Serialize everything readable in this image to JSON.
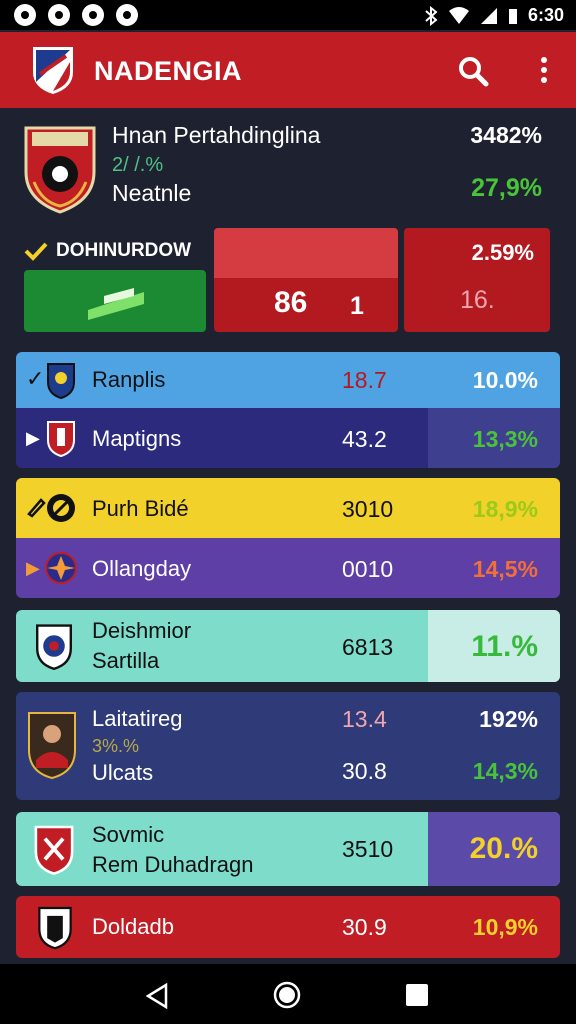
{
  "status_bar": {
    "time": "6:30",
    "icons": [
      "app-icon",
      "app-icon",
      "app-icon",
      "app-icon"
    ]
  },
  "app_bar": {
    "title": "NADENGIA"
  },
  "hero": {
    "title": "Hnan Pertahdinglina",
    "subtitle": "2/ /.%",
    "name": "Neatnle",
    "pct_top": "3482%",
    "pct_bottom": "27,9%"
  },
  "controls": {
    "download_label": "DOHINURDOW",
    "score_a": "86",
    "score_b": "1",
    "stat_top": "2.59%",
    "stat_bottom": "16."
  },
  "rows": [
    {
      "name": "Ranplis",
      "value": "18.7",
      "pct": "10.0%"
    },
    {
      "name": "Maptigns",
      "value": "43.2",
      "pct": "13,3%"
    },
    {
      "name": "Purh Bidé",
      "value": "3010",
      "pct": "18,9%"
    },
    {
      "name": "Ollangday",
      "value": "0010",
      "pct": "14,5%"
    },
    {
      "name": "Deishmior",
      "name2": "Sartilla",
      "value": "6813",
      "pct": "11.%"
    },
    {
      "name": "Laitatireg",
      "sub": "3%.%",
      "name2": "Ulcats",
      "value": "13.4",
      "value2": "30.8",
      "pct": "192%",
      "pct2": "14,3%"
    },
    {
      "name": "Sovmic",
      "name2": "Rem Duhadragn",
      "value": "3510",
      "pct": "20.%"
    },
    {
      "name": "Doldadb",
      "value": "30.9",
      "pct": "10,9%"
    }
  ],
  "colors": {
    "accent_red": "#c01d24",
    "bg": "#1e2230",
    "green": "#49c43a",
    "yellow": "#f1d12a"
  }
}
